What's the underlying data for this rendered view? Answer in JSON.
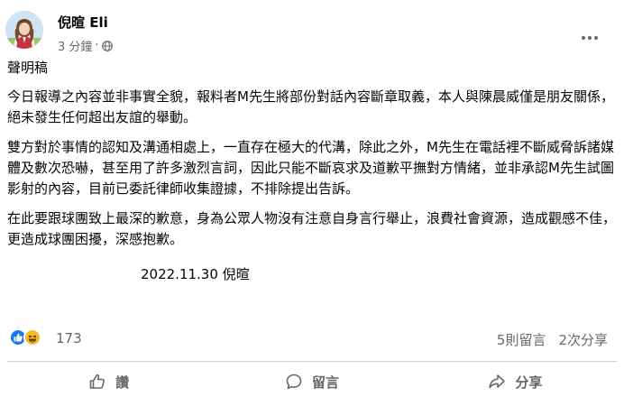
{
  "post": {
    "author": "倪暄 Eli",
    "time": "3 分鐘",
    "separator": "·",
    "audience_icon": "globe-icon",
    "title": "聲明稿",
    "paragraphs": [
      "今日報導之內容並非事實全貌，報料者M先生將部份對話內容斷章取義，本人與陳晨威僅是朋友關係，絕未發生任何超出友誼的舉動。",
      "雙方對於事情的認知及溝通相處上，一直存在極大的代溝，除此之外，M先生在電話裡不斷威脅訴諸媒體及數次恐嚇，甚至用了許多激烈言詞，因此只能不斷哀求及道歉平撫對方情緒，並非承認M先生試圖影射的內容，目前已委託律師收集證據，不排除提出告訴。",
      "在此要跟球團致上最深的歉意，身為公眾人物沒有注意自身言行舉止，浪費社會資源，造成觀感不佳，更造成球團困擾，深感抱歉。"
    ],
    "signature": "2022.11.30 倪暄"
  },
  "stats": {
    "reaction_count": "173",
    "reactions": [
      "like-icon",
      "haha-icon"
    ],
    "comments": "5則留言",
    "shares": "2次分享"
  },
  "actions": {
    "like": "讚",
    "comment": "留言",
    "share": "分享"
  },
  "colors": {
    "secondary_text": "#65676b",
    "like_blue": "#1877f2",
    "haha_yellow": "#f7b928",
    "divider": "#ced0d4"
  }
}
